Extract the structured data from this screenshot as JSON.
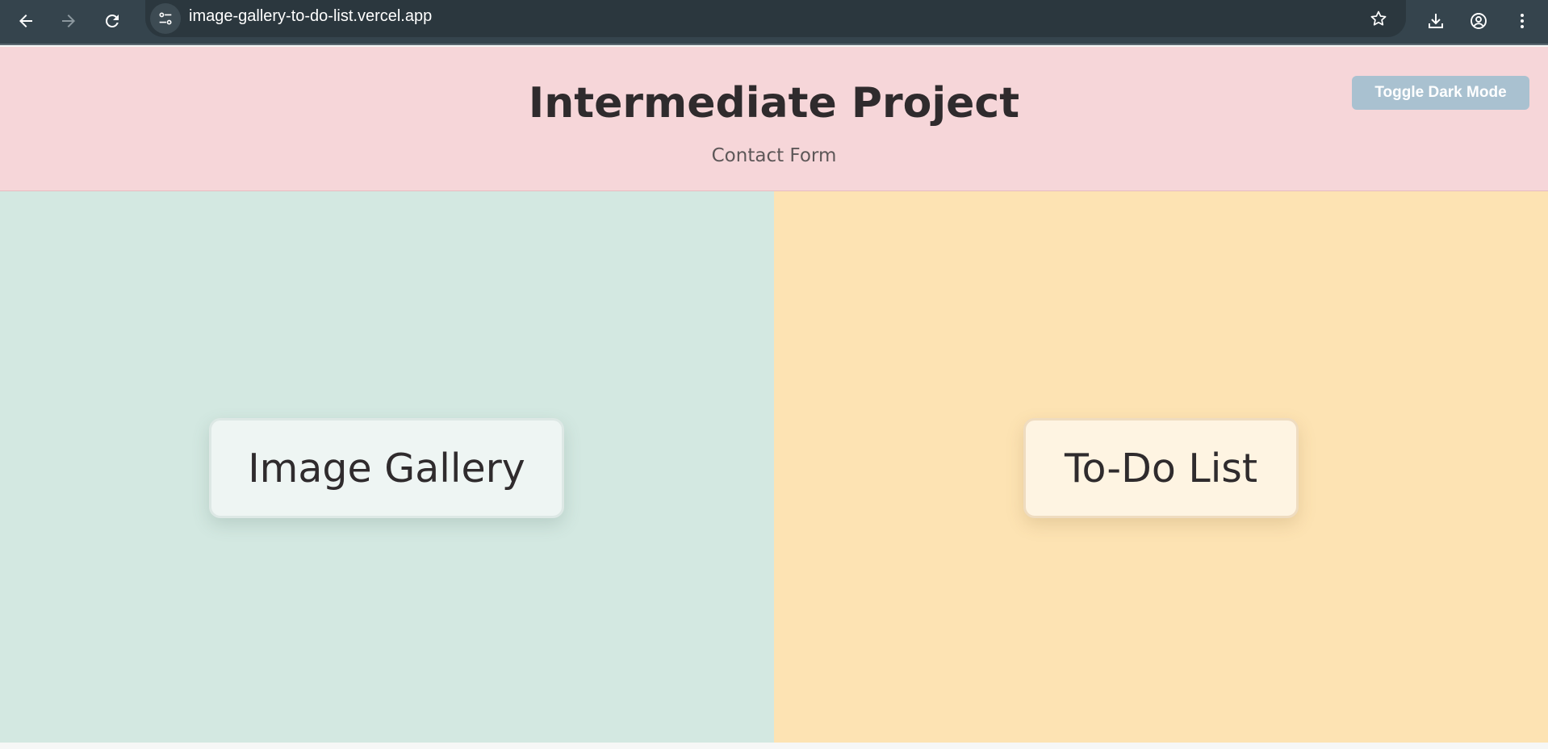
{
  "browser": {
    "url": "image-gallery-to-do-list.vercel.app",
    "icons": {
      "back": "arrow-left-icon",
      "forward": "arrow-right-icon",
      "reload": "reload-icon",
      "site_info": "tune-icon",
      "bookmark": "star-icon",
      "downloads": "download-icon",
      "profile": "account-icon",
      "menu": "kebab-menu-icon"
    }
  },
  "header": {
    "title": "Intermediate Project",
    "subtitle": "Contact Form",
    "toggle_label": "Toggle Dark Mode"
  },
  "panels": {
    "left": {
      "card_label": "Image Gallery"
    },
    "right": {
      "card_label": "To-Do List"
    }
  },
  "colors": {
    "header_bg": "#f6d6d9",
    "left_panel_bg": "#d3e8e1",
    "right_panel_bg": "#fde3b3",
    "toggle_bg": "#a9c1d0",
    "text_dark": "#2f2b2d",
    "browser_bar": "#35444d"
  }
}
